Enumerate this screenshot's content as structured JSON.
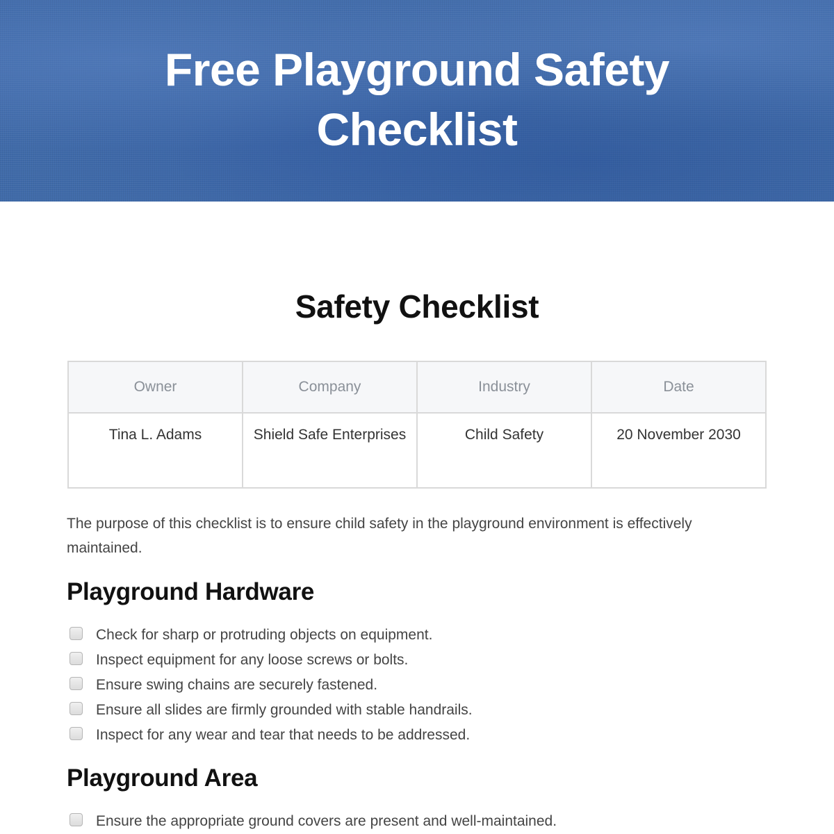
{
  "banner": {
    "title": "Free Playground Safety Checklist",
    "color": "#3f6aa9"
  },
  "document": {
    "title": "Safety Checklist",
    "info_table": {
      "headers": [
        "Owner",
        "Company",
        "Industry",
        "Date"
      ],
      "values": [
        "Tina L. Adams",
        "Shield Safe Enterprises",
        "Child Safety",
        "20 November 2030"
      ]
    },
    "purpose": "The purpose of this checklist is to ensure child safety in the playground environment is effectively maintained.",
    "sections": [
      {
        "heading": "Playground Hardware",
        "items": [
          {
            "label": "Check for sharp or protruding objects on equipment.",
            "checked": false
          },
          {
            "label": "Inspect equipment for any loose screws or bolts.",
            "checked": false
          },
          {
            "label": "Ensure swing chains are securely fastened.",
            "checked": false
          },
          {
            "label": "Ensure all slides are firmly grounded with stable handrails.",
            "checked": false
          },
          {
            "label": "Inspect for any wear and tear that needs to be addressed.",
            "checked": false
          }
        ]
      },
      {
        "heading": "Playground Area",
        "items": [
          {
            "label": "Ensure the appropriate ground covers are present and well-maintained.",
            "checked": false
          }
        ]
      }
    ]
  }
}
